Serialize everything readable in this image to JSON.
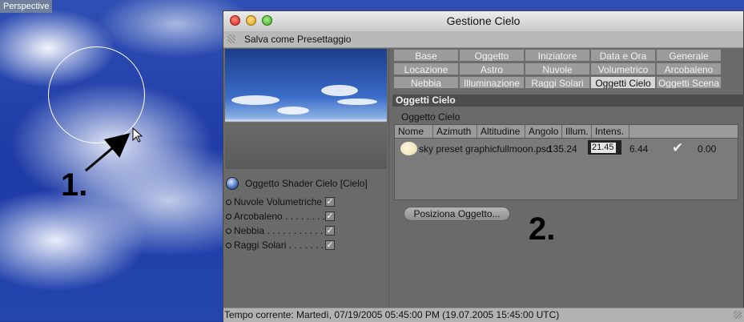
{
  "viewport": {
    "label": "Perspective"
  },
  "annotations": {
    "one": "1.",
    "two": "2."
  },
  "window": {
    "title": "Gestione Cielo",
    "menu_label": "Salva come Presettaggio"
  },
  "left_pane": {
    "shader_label": "Oggetto Shader Cielo [Cielo]",
    "options": [
      {
        "label": "Nuvole Volumetriche",
        "checked": true
      },
      {
        "label": "Arcobaleno . . . . . . . .",
        "checked": true
      },
      {
        "label": "Nebbia . . . . . . . . . . . .",
        "checked": true
      },
      {
        "label": "Raggi Solari . . . . . . . .",
        "checked": true
      }
    ]
  },
  "tabs": [
    [
      "Base",
      "Oggetto",
      "Iniziatore",
      "Data e Ora",
      "Generale"
    ],
    [
      "Locazione",
      "Astro",
      "Nuvole",
      "Volumetrico",
      "Arcobaleno"
    ],
    [
      "Nebbia",
      "Illuminazione",
      "Raggi Solari",
      "Oggetti Cielo",
      "Oggetti Scena"
    ]
  ],
  "active_tab": "Oggetti Cielo",
  "section": {
    "header": "Oggetti Cielo",
    "subheader": "Oggetto Cielo",
    "columns": [
      "Nome",
      "Azimuth",
      "Altitudine",
      "Angolo",
      "Illum.",
      "Intens."
    ],
    "row": {
      "name": "sky preset graphicfullmoon.psd",
      "angolo": "135.24",
      "intens_value": "21.45",
      "extra_value_1": "6.44",
      "extra_value_2": "0.00"
    }
  },
  "buttons": {
    "position_object": "Posiziona Oggetto..."
  },
  "status": {
    "text": "Tempo corrente:  Martedì, 07/19/2005 05:45:00 PM  (19.07.2005  15:45:00 UTC)"
  }
}
